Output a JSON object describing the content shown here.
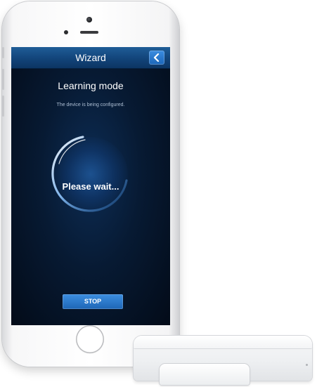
{
  "app": {
    "nav_title": "Wizard",
    "heading": "Learning mode",
    "subheading": "The device is being configured.",
    "status_text": "Please wait...",
    "stop_label": "STOP"
  },
  "icons": {
    "back": "chevron-left-icon",
    "spinner": "progress-ring-icon"
  },
  "colors": {
    "nav_bar": "#12447a",
    "accent_button": "#2a78cc",
    "screen_background": "#071a33",
    "spinner": "#8fc6ff"
  }
}
